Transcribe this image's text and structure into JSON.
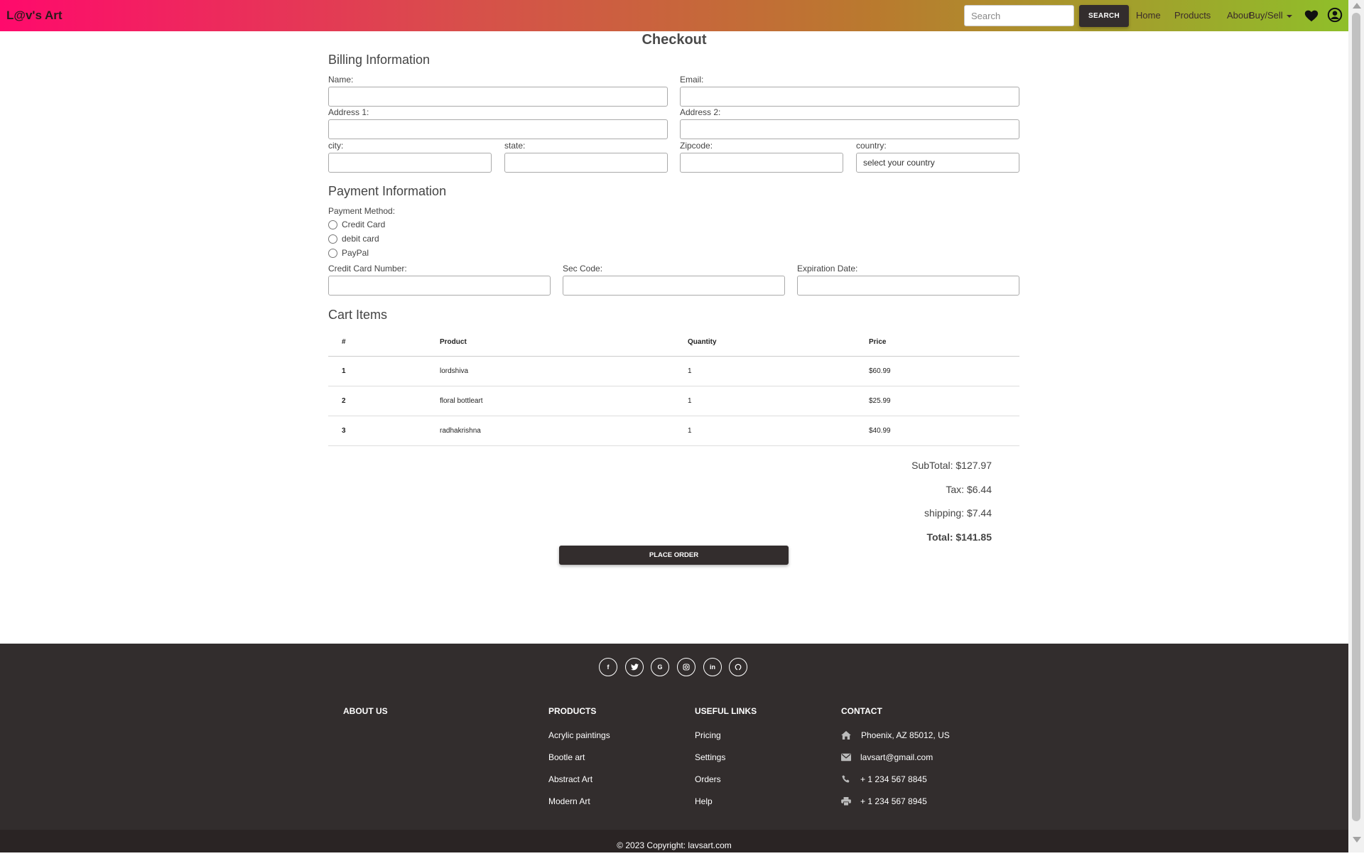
{
  "navbar": {
    "brand": "L@v's Art",
    "search_placeholder": "Search",
    "search_button": "SEARCH",
    "links": {
      "home": "Home",
      "products": "Products",
      "about": "About",
      "buy_sell": "Buy/Sell"
    },
    "icons": [
      "heart-icon",
      "user-icon"
    ]
  },
  "checkout": {
    "title": "Checkout",
    "billing": {
      "title": "Billing Information",
      "name_label": "Name:",
      "email_label": "Email:",
      "address1_label": "Address 1:",
      "address2_label": "Address 2:",
      "city_label": "city:",
      "state_label": "state:",
      "zip_label": "Zipcode:",
      "country_label": "country:",
      "country_value": "select your country"
    },
    "payment": {
      "title": "Payment Information",
      "method_label": "Payment Method:",
      "methods": [
        "Credit Card",
        "debit card",
        "PayPal"
      ],
      "card_number_label": "Credit Card Number:",
      "sec_code_label": "Sec Code:",
      "expiration_label": "Expiration Date:"
    },
    "cart": {
      "title": "Cart Items",
      "columns": [
        "#",
        "Product",
        "Quantity",
        "Price"
      ],
      "rows": [
        [
          "1",
          "lordshiva",
          "1",
          "$60.99"
        ],
        [
          "2",
          "floral bottleart",
          "1",
          "$25.99"
        ],
        [
          "3",
          "radhakrishna",
          "1",
          "$40.99"
        ]
      ]
    },
    "summary": {
      "subtotal": "SubTotal: $127.97",
      "tax": "Tax: $6.44",
      "shipping": "shipping: $7.44",
      "total": "Total: $141.85"
    },
    "place_order": "PLACE ORDER"
  },
  "footer": {
    "social_icons": [
      "facebook-icon",
      "twitter-icon",
      "google-icon",
      "instagram-icon",
      "linkedin-icon",
      "github-icon"
    ],
    "about_title": "ABOUT US",
    "products_title": "PRODUCTS",
    "products": [
      "Acrylic paintings",
      "Bootle art",
      "Abstract Art",
      "Modern Art"
    ],
    "useful_title": "USEFUL LINKS",
    "useful": [
      "Pricing",
      "Settings",
      "Orders",
      "Help"
    ],
    "contact_title": "CONTACT",
    "contact": {
      "address": "Phoenix, AZ 85012, US",
      "email": "lavsart@gmail.com",
      "phone": "+ 1 234 567 8845",
      "fax": "+ 1 234 567 8945"
    },
    "copyright": "© 2023 Copyright: lavsart.com"
  }
}
